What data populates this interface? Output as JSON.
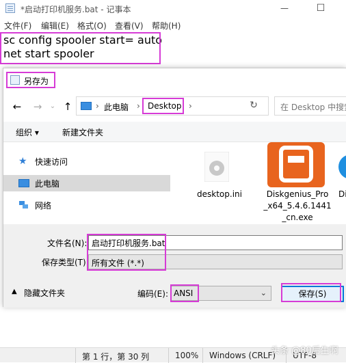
{
  "notepad": {
    "title": "*启动打印机服务.bat - 记事本",
    "window_buttons": {
      "minimize": "—",
      "maximize": "☐"
    },
    "menu": [
      "文件(F)",
      "编辑(E)",
      "格式(O)",
      "查看(V)",
      "帮助(H)"
    ],
    "content_lines": [
      "sc config spooler start= auto",
      "net start spooler"
    ],
    "status": {
      "position": "第 1 行，第 30 列",
      "zoom": "100%",
      "line_ending": "Windows (CRLF)",
      "encoding": "UTF-8"
    }
  },
  "watermark": "头条 @80后生啊",
  "dialog": {
    "title": "另存为",
    "nav": {
      "back": "←",
      "forward": "→",
      "up": "↑",
      "refresh": "↻"
    },
    "breadcrumb": [
      "此电脑",
      "Desktop"
    ],
    "search_placeholder": "在 Desktop 中搜索",
    "toolbar": {
      "organize": "组织 ▾",
      "new_folder": "新建文件夹"
    },
    "tree": [
      {
        "label": "快速访问",
        "icon": "star-icon"
      },
      {
        "label": "此电脑",
        "icon": "computer-icon",
        "selected": true
      },
      {
        "label": "网络",
        "icon": "network-icon"
      }
    ],
    "files": [
      {
        "label_lines": [
          "desktop.ini"
        ],
        "icon": "settings-file-icon"
      },
      {
        "label_lines": [
          "Diskgenius_Pro",
          "_x64_5.4.6.1441",
          "_cn.exe"
        ],
        "icon": "diskgenius-app-icon"
      },
      {
        "label_lines": [
          "Di"
        ],
        "icon": "gear-app-icon"
      }
    ],
    "filename_label": "文件名(N):",
    "filename_value": "启动打印机服务.bat",
    "filetype_label": "保存类型(T):",
    "filetype_value": "所有文件  (*.*)",
    "hide_folders": "隐藏文件夹",
    "encoding_label": "编码(E):",
    "encoding_value": "ANSI",
    "save_button": "保存(S)"
  },
  "colors": {
    "highlight": "#d63bd6",
    "accent": "#0078d7",
    "selected": "#d9d9d9"
  }
}
